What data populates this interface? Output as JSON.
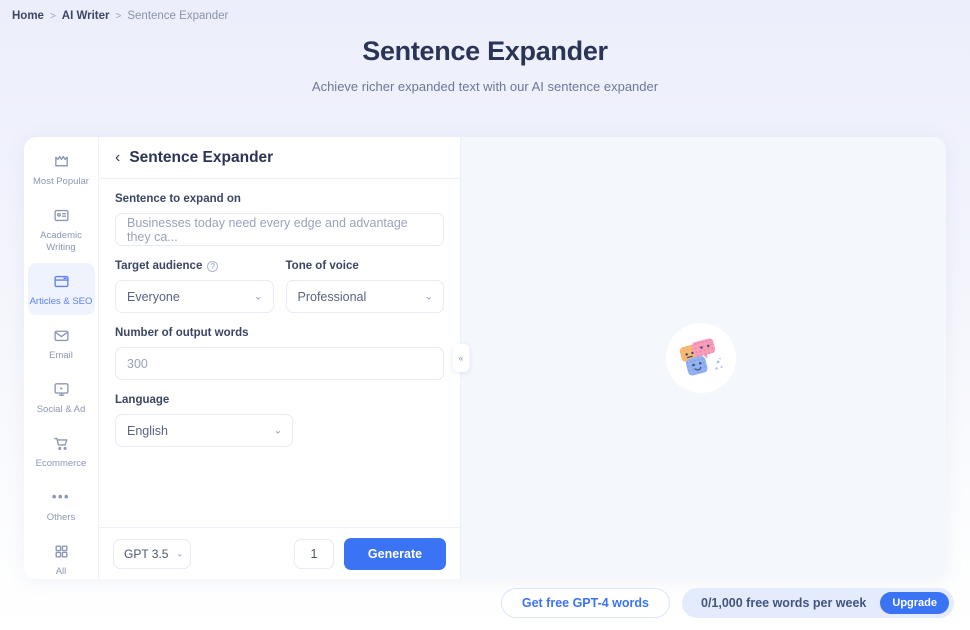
{
  "breadcrumb": {
    "home": "Home",
    "separator": ">",
    "section": "AI Writer",
    "current": "Sentence Expander"
  },
  "header": {
    "title": "Sentence Expander",
    "subtitle": "Achieve richer expanded text with our AI sentence expander"
  },
  "sidebar": {
    "items": [
      {
        "label": "Most Popular",
        "icon": "crown-icon",
        "active": false
      },
      {
        "label": "Academic Writing",
        "icon": "id-card-icon",
        "active": false
      },
      {
        "label": "Articles & SEO",
        "icon": "browser-window-icon",
        "active": true
      },
      {
        "label": "Email",
        "icon": "envelope-icon",
        "active": false
      },
      {
        "label": "Social & Ad",
        "icon": "monitor-play-icon",
        "active": false
      },
      {
        "label": "Ecommerce",
        "icon": "shopping-cart-icon",
        "active": false
      },
      {
        "label": "Others",
        "icon": "ellipsis-icon",
        "active": false
      },
      {
        "label": "All",
        "icon": "grid-icon",
        "active": false
      }
    ]
  },
  "form": {
    "back_icon": "chevron-left-icon",
    "title": "Sentence Expander",
    "sentence": {
      "label": "Sentence to expand on",
      "placeholder": "Businesses today need every edge and advantage they ca...",
      "value": ""
    },
    "target_audience": {
      "label": "Target audience",
      "help_icon": "?",
      "value": "Everyone"
    },
    "tone_of_voice": {
      "label": "Tone of voice",
      "value": "Professional"
    },
    "output_words": {
      "label": "Number of output words",
      "placeholder": "300",
      "value": ""
    },
    "language": {
      "label": "Language",
      "value": "English"
    },
    "footer": {
      "model": "GPT 3.5",
      "quantity": "1",
      "generate_label": "Generate",
      "caret": "⌄"
    }
  },
  "result": {
    "collapse_icon": "«",
    "illustration": "speech-cards-illustration"
  },
  "bottom_bar": {
    "free_words_label": "Get free GPT-4 words",
    "quota_text": "0/1,000 free words per week",
    "upgrade_label": "Upgrade"
  },
  "colors": {
    "accent": "#3b73f5",
    "active_bg": "#eef3fe",
    "active_fg": "#5b82f0",
    "title": "#2a3456",
    "muted": "#8c97b4",
    "result_bg": "#f4f7fc"
  }
}
